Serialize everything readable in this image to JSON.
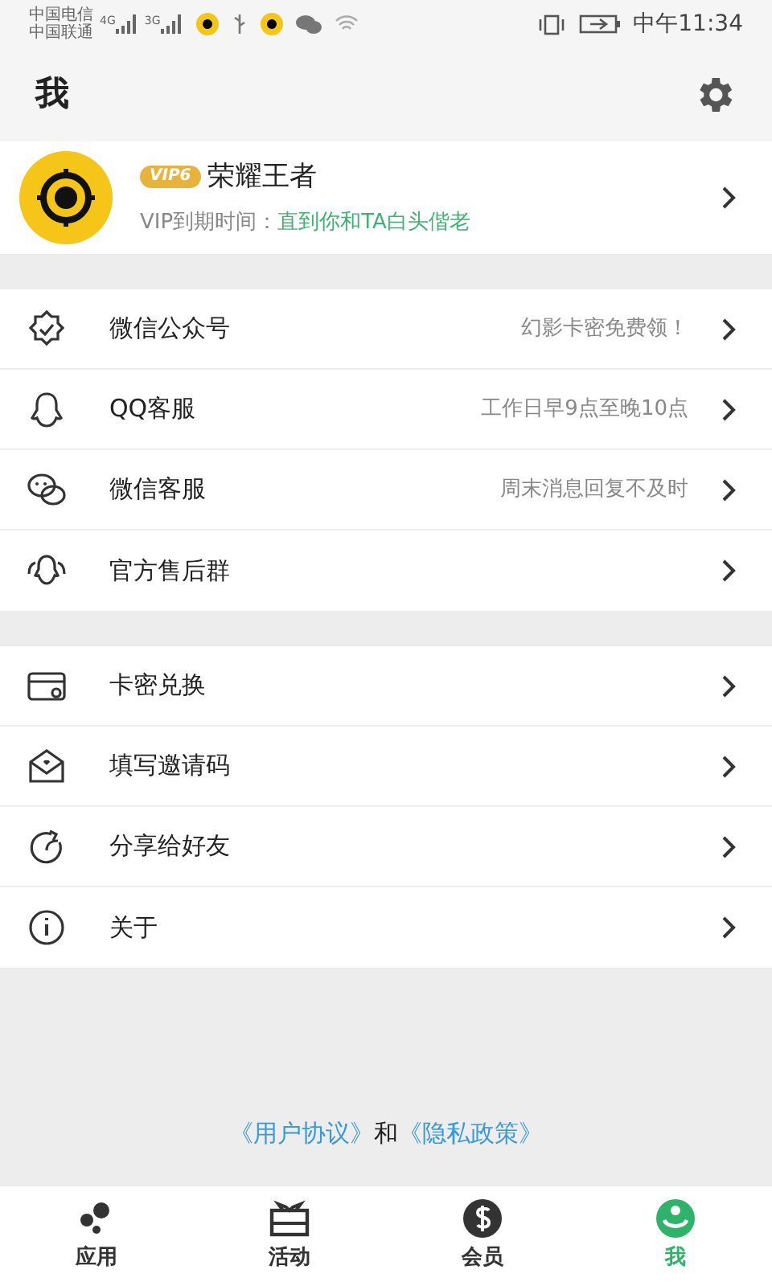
{
  "status_bar": {
    "carriers": [
      "中国电信",
      "中国联通"
    ],
    "networks": [
      "4G",
      "3G"
    ],
    "time": "中午11:34"
  },
  "header": {
    "title": "我"
  },
  "profile": {
    "badge": "VIP6",
    "name": "荣耀王者",
    "expiry_label": "VIP到期时间：",
    "expiry_value": "直到你和TA白头偕老"
  },
  "sections": [
    {
      "items": [
        {
          "label": "微信公众号",
          "hint": "幻影卡密免费领！"
        },
        {
          "label": "QQ客服",
          "hint": "工作日早9点至晚10点"
        },
        {
          "label": "微信客服",
          "hint": "周末消息回复不及时"
        },
        {
          "label": "官方售后群"
        }
      ]
    },
    {
      "items": [
        {
          "label": "卡密兑换"
        },
        {
          "label": "填写邀请码"
        },
        {
          "label": "分享给好友"
        },
        {
          "label": "关于"
        }
      ]
    }
  ],
  "footer": [
    {
      "kind": "link",
      "text": "《用户协议》"
    },
    {
      "kind": "text",
      "text": "和"
    },
    {
      "kind": "link",
      "text": "《隐私政策》"
    }
  ],
  "nav": [
    {
      "label": "应用",
      "selected": false
    },
    {
      "label": "活动",
      "selected": false
    },
    {
      "label": "会员",
      "selected": false
    },
    {
      "label": "我",
      "selected": true
    }
  ]
}
